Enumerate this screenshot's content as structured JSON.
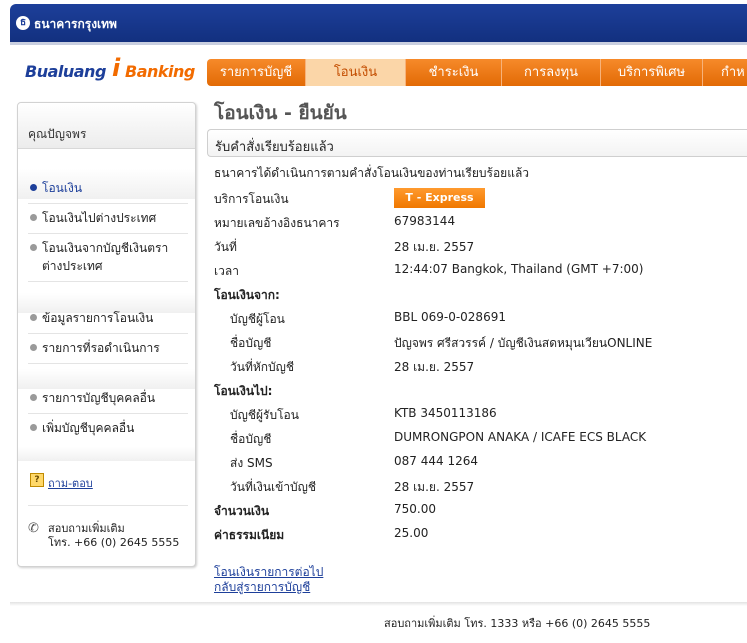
{
  "header": {
    "bank_name": "ธนาคารกรุงเทพ"
  },
  "brand": {
    "part1": "Bualuang",
    "part2": "Banking"
  },
  "nav": {
    "tabs": [
      {
        "label": "รายการบัญชี"
      },
      {
        "label": "โอนเงิน"
      },
      {
        "label": "ชำระเงิน"
      },
      {
        "label": "การลงทุน"
      },
      {
        "label": "บริการพิเศษ"
      },
      {
        "label": "กำห"
      }
    ],
    "active_index": 1
  },
  "sidebar": {
    "user_name": "คุณปัญจพร",
    "items": [
      {
        "label": "โอนเงิน"
      },
      {
        "label": "โอนเงินไปต่างประเทศ"
      },
      {
        "label": "โอนเงินจากบัญชีเงินตราต่างประเทศ"
      },
      {
        "label": "ข้อมูลรายการโอนเงิน"
      },
      {
        "label": "รายการที่รอดำเนินการ"
      },
      {
        "label": "รายการบัญชีบุคคลอื่น"
      },
      {
        "label": "เพิ่มบัญชีบุคคลอื่น"
      }
    ],
    "help_label": "ถาม-ตอบ",
    "contact_line1": "สอบถามเพิ่มเติม",
    "contact_line2": "โทร. +66 (0) 2645 5555"
  },
  "main": {
    "title": "โอนเงิน - ยืนยัน",
    "notice": "รับคำสั่งเรียบร้อยแล้ว",
    "success_message": "ธนาคารได้ดำเนินการตามคำสั่งโอนเงินของท่านเรียบร้อยแล้ว",
    "details": {
      "service_label": "บริการโอนเงิน",
      "service_value": "T - Express",
      "ref_label": "หมายเลขอ้างอิงธนาคาร",
      "ref_value": "67983144",
      "date_label": "วันที่",
      "date_value": "28 เม.ย. 2557",
      "time_label": "เวลา",
      "time_value": "12:44:07 Bangkok, Thailand (GMT +7:00)",
      "from_heading": "โอนเงินจาก:",
      "from_account_label": "บัญชีผู้โอน",
      "from_account_value": "BBL 069-0-028691",
      "from_name_label": "ชื่อบัญชี",
      "from_name_value": "ปัญจพร ศรีสวรรค์ / บัญชีเงินสดหมุนเวียนONLINE",
      "debit_date_label": "วันที่หักบัญชี",
      "debit_date_value": "28 เม.ย. 2557",
      "to_heading": "โอนเงินไป:",
      "to_account_label": "บัญชีผู้รับโอน",
      "to_account_value": "KTB 3450113186",
      "to_name_label": "ชื่อบัญชี",
      "to_name_value": "DUMRONGPON ANAKA / ICAFE ECS BLACK",
      "sms_label": "ส่ง SMS",
      "sms_value": "087 444 1264",
      "credit_date_label": "วันที่เงินเข้าบัญชี",
      "credit_date_value": "28 เม.ย. 2557",
      "amount_label": "จำนวนเงิน",
      "amount_value": "750.00",
      "fee_label": "ค่าธรรมเนียม",
      "fee_value": "25.00"
    },
    "link_next_transfer": "โอนเงินรายการต่อไป",
    "link_back_accounts": "กลับสู่รายการบัญชี"
  },
  "footer": {
    "text": "สอบถามเพิ่มเติม โทร. 1333 หรือ +66 (0) 2645 5555"
  },
  "colors": {
    "brand_blue": "#1d3f9a",
    "brand_orange": "#f26b00",
    "nav_orange": "#e26a05"
  }
}
